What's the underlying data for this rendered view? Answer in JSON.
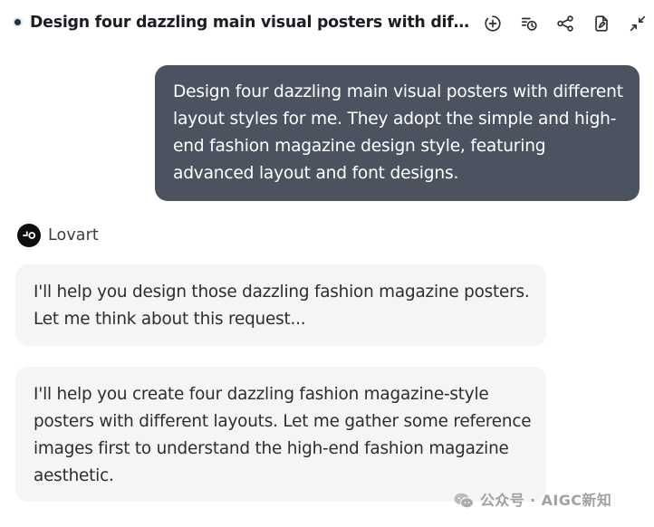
{
  "header": {
    "title": "Design four dazzling main visual posters with different l...",
    "icons": [
      "add-circle-icon",
      "history-icon",
      "share-icon",
      "document-edit-icon",
      "collapse-icon"
    ]
  },
  "conversation": {
    "user_message": "Design four dazzling main visual posters with different layout styles for me. They adopt the simple and high-end fashion magazine design style, featuring advanced layout and font designs.",
    "assistant": {
      "name": "Lovart",
      "messages": [
        "I'll help you design those dazzling fashion magazine posters. Let me think about this request...",
        "I'll help you create four dazzling fashion magazine-style posters with different layouts. Let me gather some reference images first to understand the high-end fashion magazine aesthetic."
      ]
    }
  },
  "watermark": {
    "text": "公众号 · AIGC新知"
  },
  "colors": {
    "user_bubble": "#4b5360",
    "assistant_bubble": "#f5f5f6",
    "avatar": "#0f0f10"
  }
}
